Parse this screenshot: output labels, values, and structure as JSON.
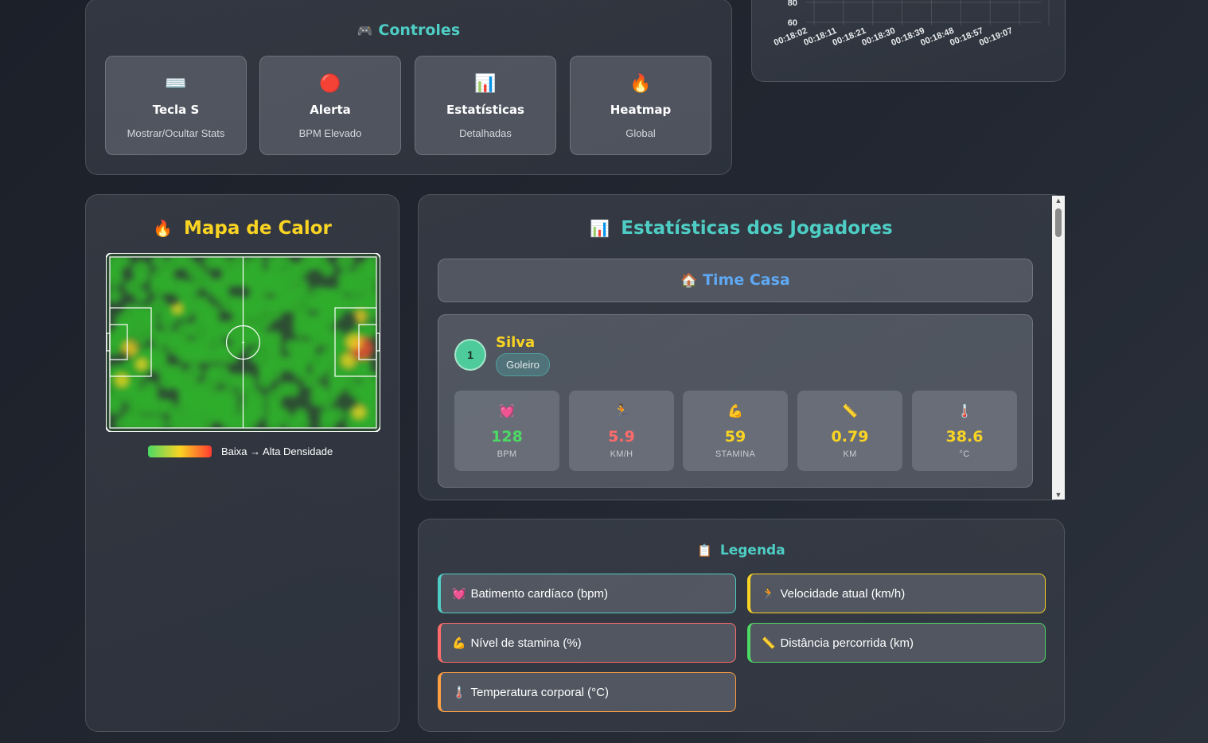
{
  "controls": {
    "title": "Controles",
    "title_icon": "gamepad-icon",
    "cards": [
      {
        "icon": "keyboard-icon",
        "glyph": "⌨️",
        "title": "Tecla S",
        "subtitle": "Mostrar/Ocultar Stats"
      },
      {
        "icon": "red-circle-icon",
        "glyph": "🔴",
        "title": "Alerta",
        "subtitle": "BPM Elevado"
      },
      {
        "icon": "bar-chart-icon",
        "glyph": "📊",
        "title": "Estatísticas",
        "subtitle": "Detalhadas"
      },
      {
        "icon": "fire-icon",
        "glyph": "🔥",
        "title": "Heatmap",
        "subtitle": "Global"
      }
    ]
  },
  "chart_data": {
    "type": "line",
    "title": "",
    "xlabel": "",
    "ylabel": "",
    "y_ticks": [
      "80",
      "60"
    ],
    "x": [
      "00:18:02",
      "00:18:11",
      "00:18:21",
      "00:18:30",
      "00:18:39",
      "00:18:48",
      "00:18:57",
      "00:19:07"
    ],
    "series": [],
    "grid": true
  },
  "heatmap": {
    "title": "Mapa de Calor",
    "title_icon": "fire-icon",
    "legend_text": "Baixa → Alta Densidade",
    "colors": {
      "low": "#4cd964",
      "mid": "#f9d423",
      "high": "#ff3b30"
    }
  },
  "stats": {
    "title": "Estatísticas dos Jogadores",
    "title_icon": "bar-chart-icon",
    "team": {
      "icon": "house-icon",
      "label": "Time Casa"
    },
    "player": {
      "number": "1",
      "name": "Silva",
      "position": "Goleiro",
      "metrics": [
        {
          "icon": "heart-icon",
          "glyph": "💓",
          "value": "128",
          "label": "BPM",
          "color": "#4cd964"
        },
        {
          "icon": "runner-icon",
          "glyph": "🏃",
          "value": "5.9",
          "label": "KM/H",
          "color": "#ff6b6b"
        },
        {
          "icon": "muscle-icon",
          "glyph": "💪",
          "value": "59",
          "label": "STAMINA",
          "color": "#f9d423"
        },
        {
          "icon": "ruler-icon",
          "glyph": "📏",
          "value": "0.79",
          "label": "KM",
          "color": "#f9d423"
        },
        {
          "icon": "thermometer-icon",
          "glyph": "🌡️",
          "value": "38.6",
          "label": "°C",
          "color": "#f9d423"
        }
      ]
    }
  },
  "legend": {
    "title": "Legenda",
    "title_icon": "clipboard-icon",
    "items": [
      {
        "icon": "heart-icon",
        "glyph": "💓",
        "label": "Batimento cardíaco (bpm)",
        "color": "#4ecdc4"
      },
      {
        "icon": "runner-icon",
        "glyph": "🏃",
        "label": "Velocidade atual (km/h)",
        "color": "#f9d423"
      },
      {
        "icon": "muscle-icon",
        "glyph": "💪",
        "label": "Nível de stamina (%)",
        "color": "#ff6b6b"
      },
      {
        "icon": "ruler-icon",
        "glyph": "📏",
        "label": "Distância percorrida (km)",
        "color": "#4cd964"
      },
      {
        "icon": "thermometer-icon",
        "glyph": "🌡️",
        "label": "Temperatura corporal (°C)",
        "color": "#ff9f43"
      }
    ]
  }
}
